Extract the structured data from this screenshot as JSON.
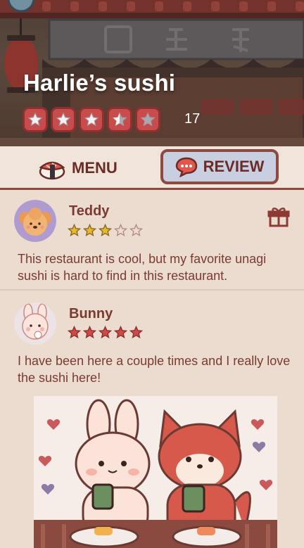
{
  "restaurant": {
    "name": "Harlie’s sushi",
    "rating_stars": 3.5,
    "rating_count": "17"
  },
  "tabs": {
    "menu_label": "MENU",
    "review_label": "REVIEW",
    "active": "review"
  },
  "reviews": [
    {
      "name": "Teddy",
      "stars": 3,
      "text": "This restaurant is cool, but my favorite unagi sushi is hard to find in this restaurant.",
      "icon": "gift-icon"
    },
    {
      "name": "Bunny",
      "stars": 5,
      "text": "I have been here a couple times and I really love the sushi here!",
      "icon": "photo-of-bunny-and-fox-eating-sushi"
    }
  ],
  "colors": {
    "accent": "#c94c4c",
    "text": "#7a3a32",
    "tab_active": "#c9cfe0",
    "star_gold": "#e7b92f"
  }
}
